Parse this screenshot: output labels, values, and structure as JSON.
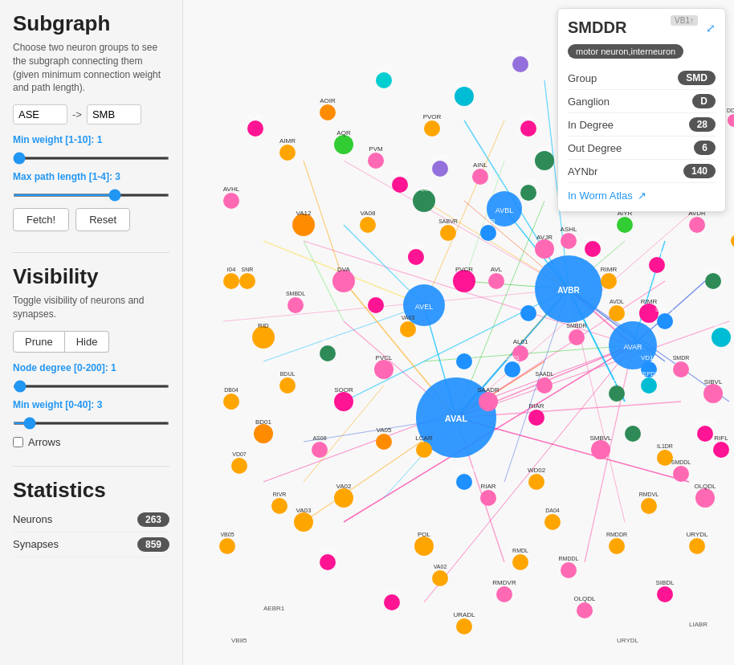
{
  "leftPanel": {
    "subgraph": {
      "title": "Subgraph",
      "description": "Choose two neuron groups to see the subgraph connecting them (given minimum connection weight and path length).",
      "sourceInput": "ASE",
      "arrowLabel": "->",
      "targetInput": "SMB",
      "minWeightLabel": "Min weight [1-10]:",
      "minWeightValue": "1",
      "minWeightMin": 1,
      "minWeightMax": 10,
      "minWeightCurrent": 1,
      "maxPathLabel": "Max path length [1-4]:",
      "maxPathValue": "3",
      "maxPathMin": 1,
      "maxPathMax": 4,
      "maxPathCurrent": 3,
      "fetchLabel": "Fetch!",
      "resetLabel": "Reset"
    },
    "visibility": {
      "title": "Visibility",
      "description": "Toggle visibility of neurons and synapses.",
      "pruneLabel": "Prune",
      "hideLabel": "Hide",
      "nodeDegreeLabel": "Node degree [0-200]:",
      "nodeDegreeValue": "1",
      "nodeDegreeMin": 0,
      "nodeDegreeMax": 200,
      "nodeDegreeCurrent": 1,
      "minWeightLabel": "Min weight [0-40]:",
      "minWeightValue": "3",
      "minWeightMin": 0,
      "minWeightMax": 40,
      "minWeightCurrent": 3,
      "arrowsLabel": "Arrows"
    },
    "statistics": {
      "title": "Statistics",
      "neuronsLabel": "Neurons",
      "neuronsCount": "263",
      "synapsesLabel": "Synapses",
      "synapsesCount": "859"
    }
  },
  "rightPanel": {
    "nodeTitle": "SMDDR",
    "vbBadge": "VB1↑",
    "nodeType": "motor neuron,interneuron",
    "groupLabel": "Group",
    "groupValue": "SMD",
    "ganglionLabel": "Ganglion",
    "ganglionValue": "D",
    "inDegreeLabel": "In Degree",
    "inDegreeValue": "28",
    "outDegreeLabel": "Out Degree",
    "outDegreeValue": "6",
    "ayNbrLabel": "AYNbr",
    "ayNbrValue": "140",
    "wormAtlasLabel": "In Worm Atlas",
    "expandIconLabel": "⤢"
  }
}
